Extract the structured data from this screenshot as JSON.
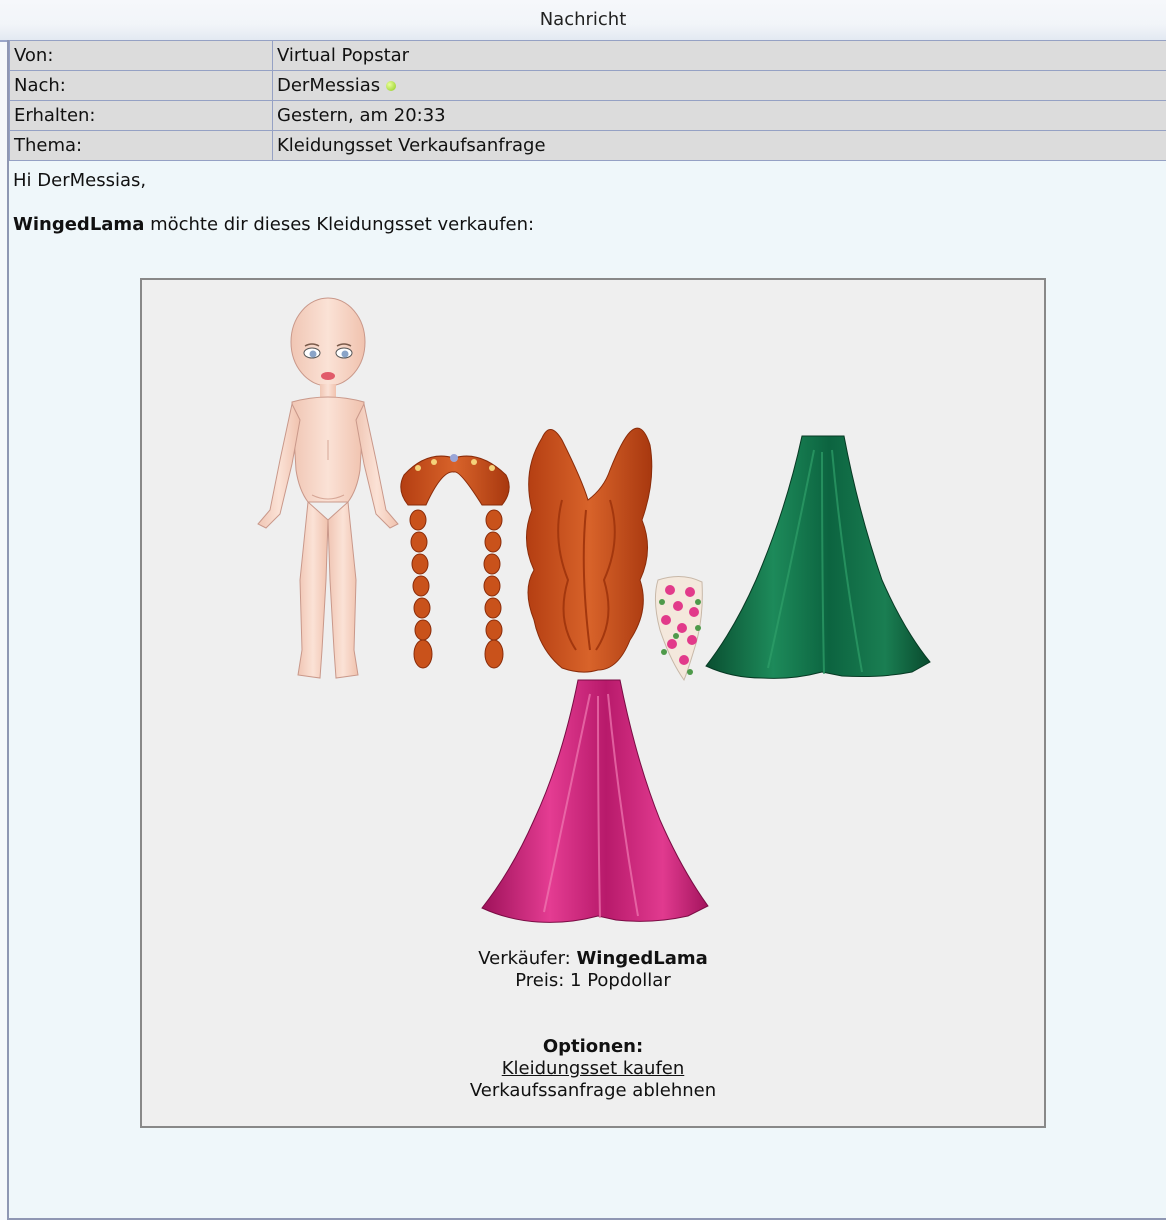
{
  "header": {
    "title": "Nachricht"
  },
  "meta": {
    "from_label": "Von:",
    "from_value": "Virtual Popstar",
    "to_label": "Nach:",
    "to_value": "DerMessias",
    "received_label": "Erhalten:",
    "received_value": "Gestern, am 20:33",
    "subject_label": "Thema:",
    "subject_value": "Kleidungsset Verkaufsanfrage"
  },
  "message": {
    "greeting": "Hi DerMessias,",
    "seller_name": "WingedLama",
    "offer_text": " möchte dir dieses Kleidungsset verkaufen:"
  },
  "offer": {
    "seller_label": "Verkäufer: ",
    "seller_name": "WingedLama",
    "price_text": "Preis: 1 Popdollar",
    "options_label": "Optionen:",
    "buy_link": "Kleidungsset kaufen",
    "decline_link": "Verkaufssanfrage ablehnen"
  },
  "items": [
    "doll-base",
    "braided-hair-accessory",
    "long-red-wavy-hair",
    "rose-corsage",
    "green-satin-skirt",
    "pink-satin-skirt"
  ],
  "colors": {
    "header_border": "#9aa6c9",
    "cell_bg": "#dcdcdc",
    "body_bg": "#eff7fa",
    "card_bg": "#efefef",
    "online_dot": "#8ecb1c",
    "green_skirt": "#0f6d45",
    "pink_skirt": "#d0237f",
    "hair": "#c8501c"
  }
}
